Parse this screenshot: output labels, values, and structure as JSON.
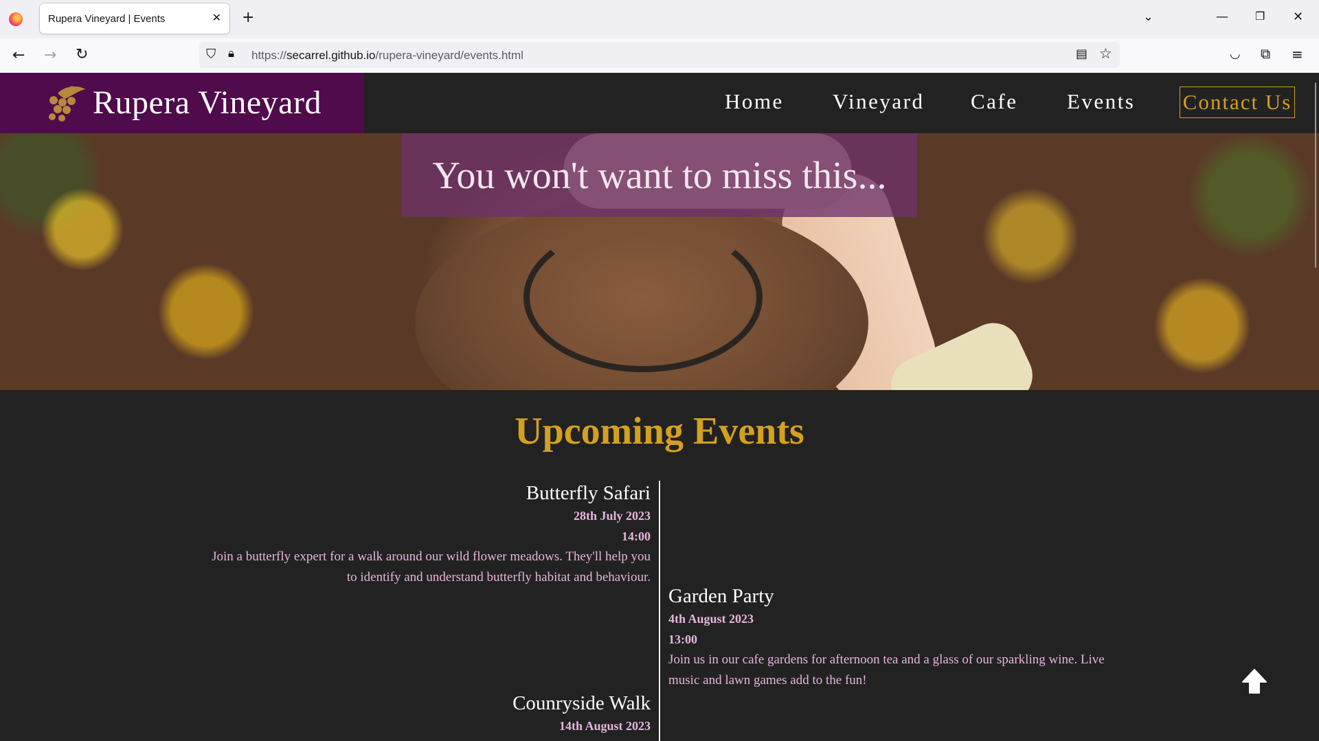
{
  "browser": {
    "tab_title": "Rupera Vineyard | Events",
    "url_prefix": "https://",
    "url_host": "secarrel.github.io",
    "url_path": "/rupera-vineyard/events.html",
    "icons": [
      "firefox-logo",
      "close-icon",
      "plus-icon",
      "chevron-down-icon",
      "minimize-icon",
      "restore-icon",
      "back-icon",
      "forward-icon",
      "reload-icon",
      "shield-icon",
      "lock-icon",
      "reader-view-icon",
      "star-icon",
      "pocket-icon",
      "extensions-icon",
      "menu-icon"
    ]
  },
  "site": {
    "brand_name": "Rupera Vineyard",
    "brand_color": "#4f0b4b",
    "accent_color": "#d4a020",
    "nav": {
      "home": "Home",
      "vineyard": "Vineyard",
      "cafe": "Cafe",
      "events": "Events",
      "contact": "Contact Us"
    },
    "hero_caption": "You won't want to miss this...",
    "section_title": "Upcoming Events",
    "events": [
      {
        "title": "Butterfly Safari",
        "date": "28th July 2023",
        "time": "14:00",
        "description": "Join a butterfly expert for a walk around our wild flower meadows. They'll help you to identify and understand butterfly habitat and behaviour."
      },
      {
        "title": "Garden Party",
        "date": "4th August 2023",
        "time": "13:00",
        "description": "Join us in our cafe gardens for afternoon tea and a glass of our sparkling wine. Live music and lawn games add to the fun!"
      },
      {
        "title": "Counryside Walk",
        "date": "14th August 2023"
      }
    ]
  }
}
